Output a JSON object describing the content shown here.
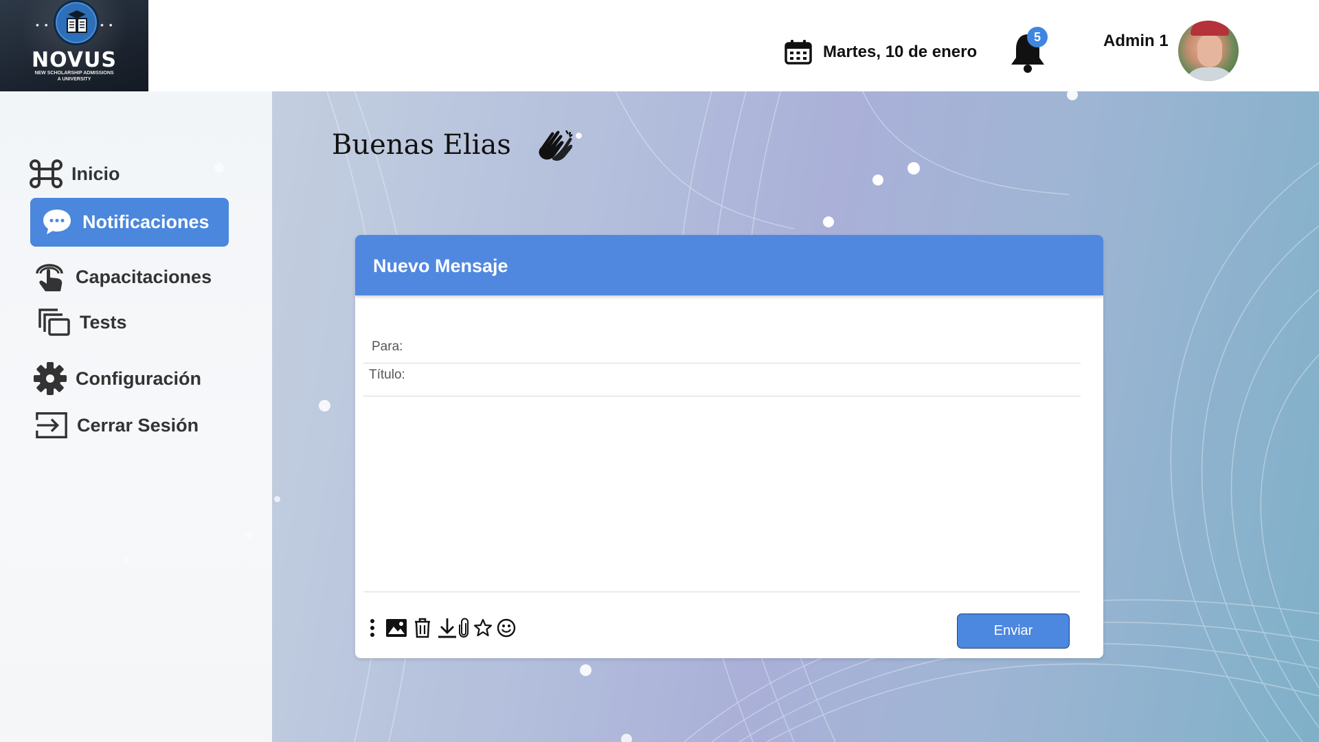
{
  "app": {
    "logo_name": "NOVUS",
    "logo_subtitle_line1": "NEW SCHOLARSHIP ADMISSIONS",
    "logo_subtitle_line2": "A UNIVERSITY"
  },
  "header": {
    "date": "Martes, 10 de enero",
    "notification_count": "5",
    "user_name": "Admin 1"
  },
  "sidebar": {
    "items": [
      {
        "label": "Inicio",
        "icon": "command-icon",
        "active": false
      },
      {
        "label": "Notificaciones",
        "icon": "chat-bubble-icon",
        "active": true
      },
      {
        "label": "Capacitaciones",
        "icon": "touch-hand-icon",
        "active": false
      },
      {
        "label": "Tests",
        "icon": "stacked-windows-icon",
        "active": false
      },
      {
        "label": "Configuración",
        "icon": "gear-icon",
        "active": false
      },
      {
        "label": "Cerrar Sesión",
        "icon": "logout-icon",
        "active": false
      }
    ]
  },
  "main": {
    "greeting": "Buenas Elias",
    "greeting_icon": "clapping-hands-icon"
  },
  "compose": {
    "title": "Nuevo Mensaje",
    "to_label": "Para:",
    "to_value": "",
    "subject_label": "Título:",
    "subject_value": "",
    "body_value": "",
    "toolbar_icons": [
      "more-vertical-icon",
      "image-icon",
      "trash-icon",
      "download-icon",
      "paperclip-icon",
      "star-icon",
      "emoji-icon"
    ],
    "send_label": "Enviar"
  },
  "colors": {
    "accent": "#4a87dd",
    "card_header": "#5188df",
    "badge": "#3f86e0"
  }
}
